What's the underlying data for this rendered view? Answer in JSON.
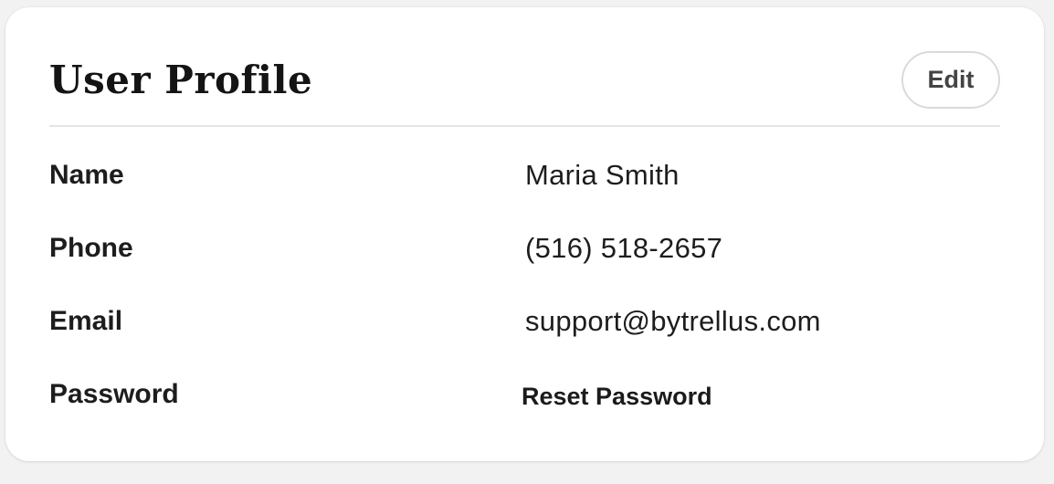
{
  "profile": {
    "title": "User Profile",
    "edit_label": "Edit",
    "fields": [
      {
        "label": "Name",
        "value": "Maria Smith"
      },
      {
        "label": "Phone",
        "value": "(516) 518-2657"
      },
      {
        "label": "Email",
        "value": "support@bytrellus.com"
      },
      {
        "label": "Password",
        "action_label": "Reset Password"
      }
    ]
  }
}
